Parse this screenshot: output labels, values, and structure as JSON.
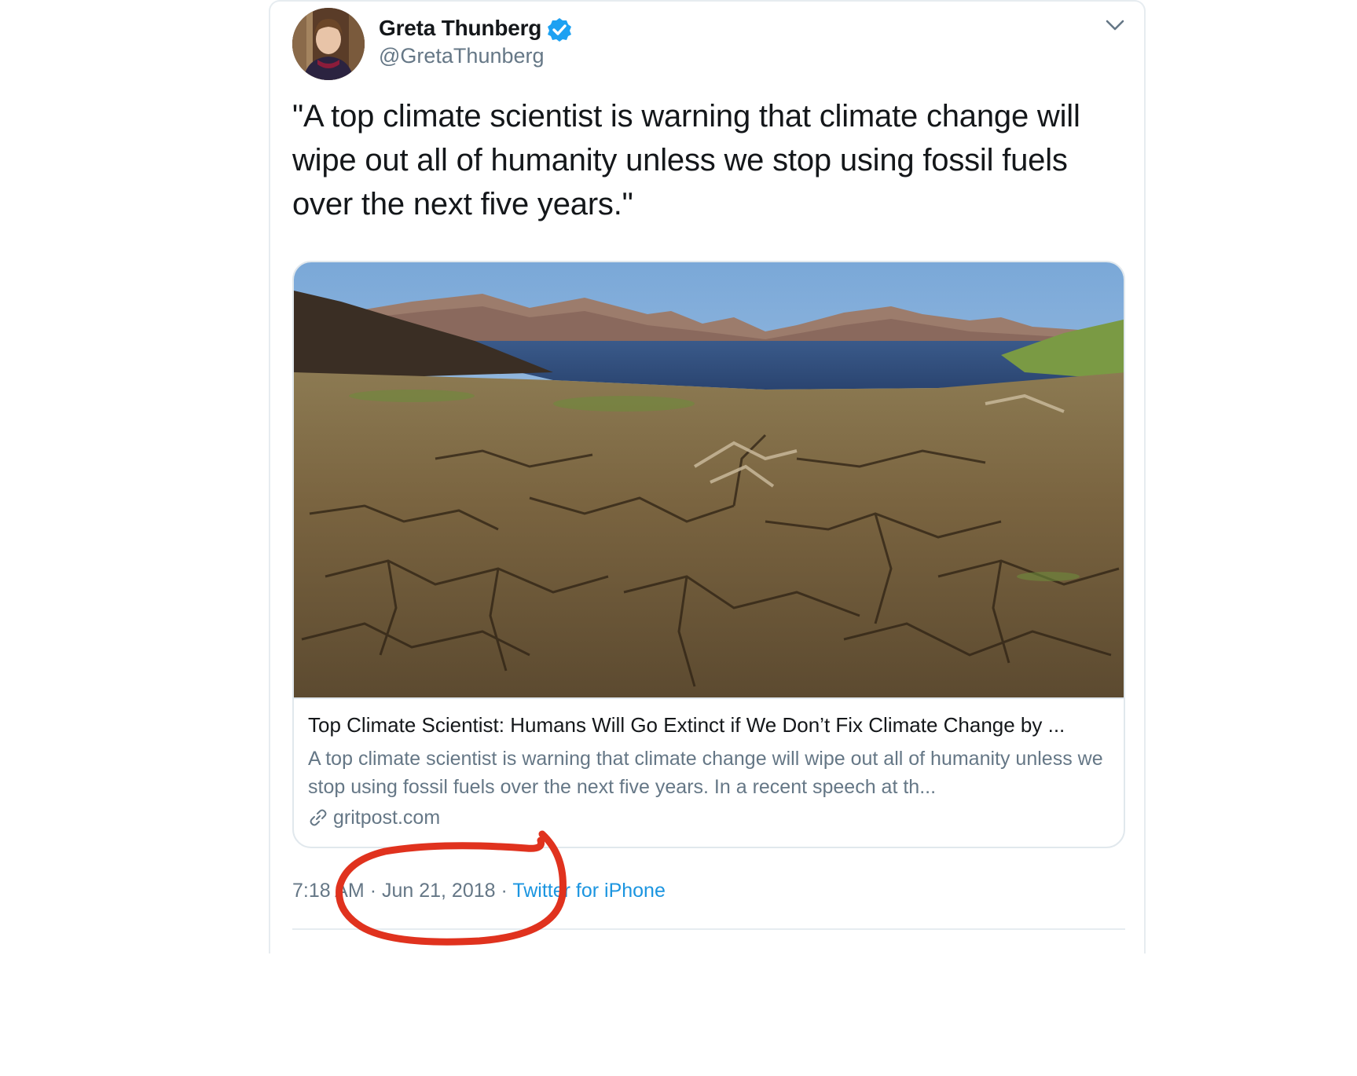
{
  "user": {
    "name": "Greta Thunberg",
    "handle": "@GretaThunberg",
    "verified": true
  },
  "tweet": {
    "text": "\"A top climate scientist is warning that climate change will wipe out all of humanity unless we stop using fossil fuels over the next five years.\""
  },
  "link_card": {
    "title": "Top Climate Scientist: Humans Will Go Extinct if We Don’t Fix Climate Change by ...",
    "description": "A top climate scientist is warning that climate change will wipe out all of humanity unless we stop using fossil fuels over the next five years. In a recent speech at th...",
    "domain": "gritpost.com",
    "image_subject": "dry cracked lakebed with mountains and water"
  },
  "meta": {
    "time": "7:18 AM",
    "separator": "·",
    "date": "Jun 21, 2018",
    "source": "Twitter for iPhone"
  },
  "icons": {
    "verified": "verified-badge-icon",
    "caret": "chevron-down-icon",
    "link": "link-icon"
  },
  "colors": {
    "text": "#14171a",
    "secondary": "#657786",
    "link_blue": "#1b95e0",
    "verified_blue": "#1da1f2",
    "annotation_red": "#e0321e",
    "border": "#e1e8ed"
  }
}
